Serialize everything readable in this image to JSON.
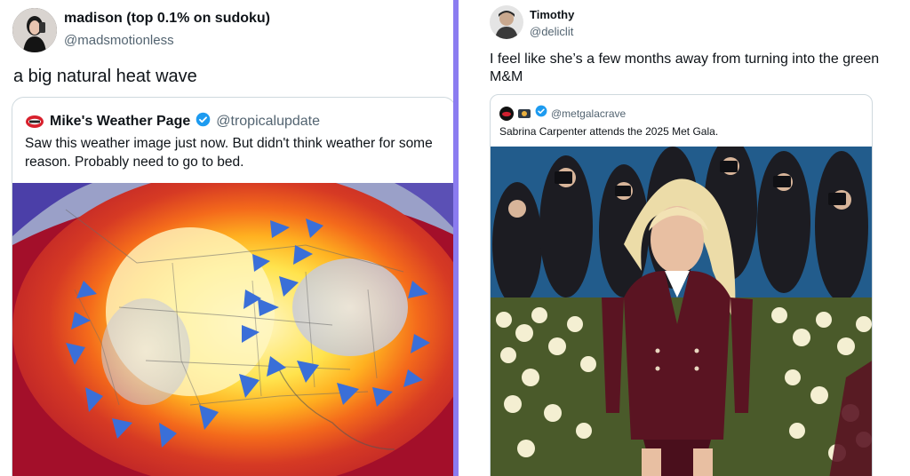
{
  "left_post": {
    "display_name": "madison (top 0.1% on sudoku)",
    "handle": "@madsmotionless",
    "text": "a big natural heat wave",
    "quote": {
      "display_name": "Mike's Weather Page",
      "handle": "@tropicalupdate",
      "text": "Saw this weather image just now. But didn't think weather for some reason. Probably need to go to bed.",
      "media_icon": "weather-map-image"
    }
  },
  "right_post": {
    "display_name": "Timothy",
    "handle": "@deliclit",
    "text": "I feel like she’s a few months away from turning into the green M&M",
    "quote": {
      "handle": "@metgalacrave",
      "text": "Sabrina Carpenter attends the 2025 Met Gala.",
      "media_icon": "red-carpet-photo"
    }
  },
  "colors": {
    "divider": "#8b7cf0",
    "verified": "#1d9bf0",
    "handle_gray": "#536471",
    "heat_red": "#b5142e",
    "heat_yellow": "#ffe34d",
    "suit_burgundy": "#5a1422"
  }
}
